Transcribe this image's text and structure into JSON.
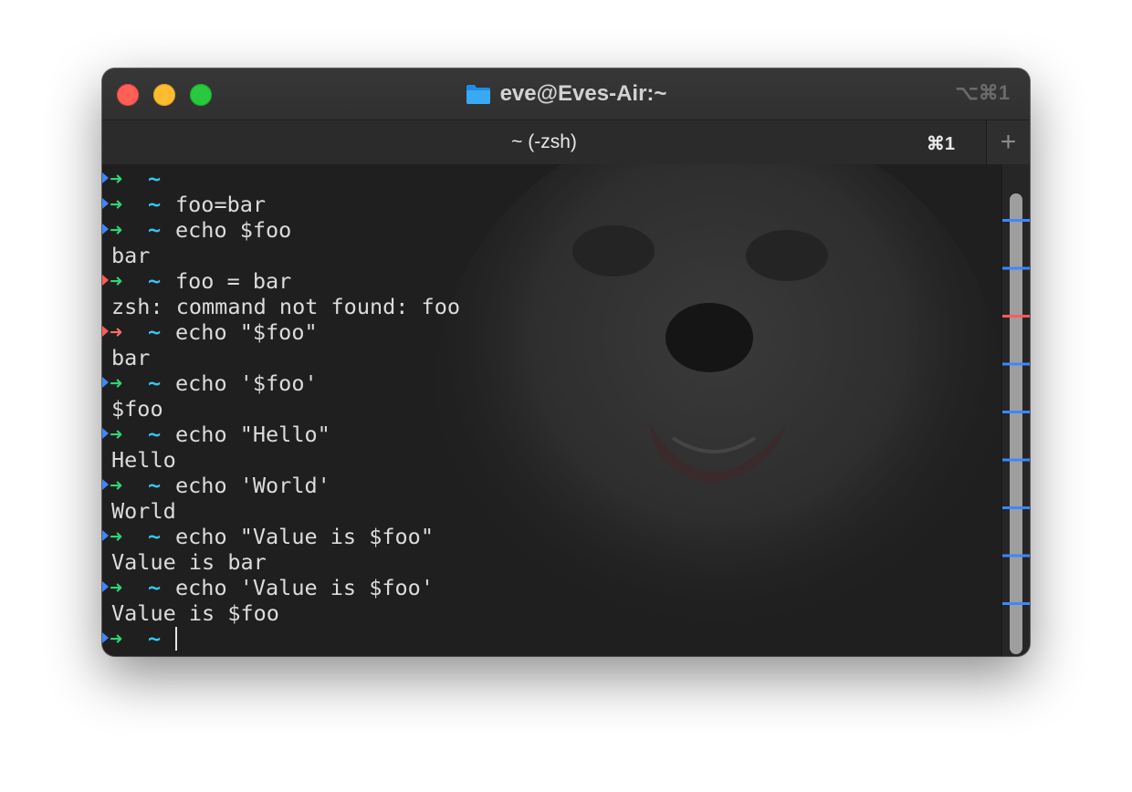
{
  "window": {
    "title": "eve@Eves-Air:~",
    "shortcut": "⌥⌘1",
    "folder_icon": "folder-icon",
    "traffic_lights": {
      "close": "#fe5f57",
      "minimize": "#febc2e",
      "zoom": "#28c840"
    }
  },
  "tab": {
    "title": "~ (-zsh)",
    "shortcut": "⌘1",
    "new_tab_label": "+"
  },
  "colors": {
    "prompt_arrow": "#2ed573",
    "prompt_arrow_error": "#ff6b6b",
    "prompt_tilde": "#33c6f5",
    "marker_ok": "#3f86ff",
    "marker_error": "#ff5a5a",
    "text": "#dcdcdc"
  },
  "prompt": {
    "arrow": "➜",
    "dir": "~"
  },
  "terminal": [
    {
      "type": "prompt",
      "status": "ok",
      "command": ""
    },
    {
      "type": "prompt",
      "status": "ok",
      "command": "foo=bar"
    },
    {
      "type": "prompt",
      "status": "ok",
      "command": "echo $foo"
    },
    {
      "type": "output",
      "text": "bar"
    },
    {
      "type": "prompt",
      "status": "ok",
      "marker": "error",
      "command": "foo = bar"
    },
    {
      "type": "output",
      "text": "zsh: command not found: foo"
    },
    {
      "type": "prompt",
      "status": "error",
      "command": "echo \"$foo\""
    },
    {
      "type": "output",
      "text": "bar"
    },
    {
      "type": "prompt",
      "status": "ok",
      "command": "echo '$foo'"
    },
    {
      "type": "output",
      "text": "$foo"
    },
    {
      "type": "prompt",
      "status": "ok",
      "command": "echo \"Hello\""
    },
    {
      "type": "output",
      "text": "Hello"
    },
    {
      "type": "prompt",
      "status": "ok",
      "command": "echo 'World'"
    },
    {
      "type": "output",
      "text": "World"
    },
    {
      "type": "prompt",
      "status": "ok",
      "command": "echo \"Value is $foo\""
    },
    {
      "type": "output",
      "text": "Value is bar"
    },
    {
      "type": "prompt",
      "status": "ok",
      "command": "echo 'Value is $foo'"
    },
    {
      "type": "output",
      "text": "Value is $foo"
    },
    {
      "type": "prompt",
      "status": "ok",
      "command": "",
      "cursor": true
    }
  ],
  "scrollbar_marks": [
    "ok",
    "ok",
    "error",
    "ok",
    "ok",
    "ok",
    "ok",
    "ok",
    "ok"
  ]
}
